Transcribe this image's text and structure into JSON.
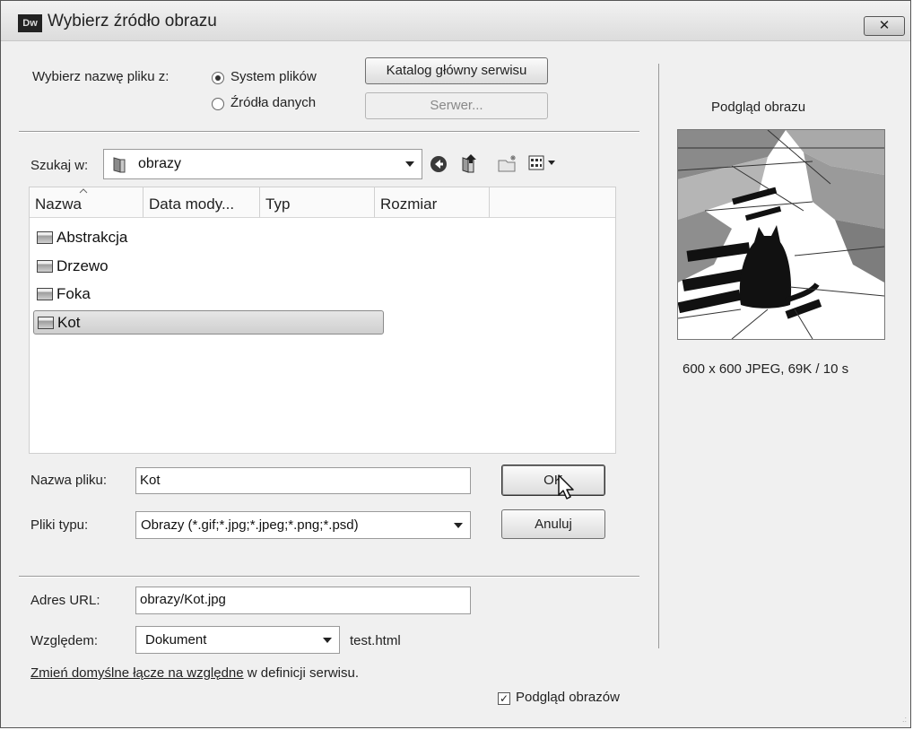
{
  "window": {
    "app_icon_text": "Dw",
    "title": "Wybierz źródło obrazu",
    "close_label": "✕"
  },
  "source": {
    "label": "Wybierz nazwę pliku z:",
    "option_filesystem": "System plików",
    "option_datasources": "Źródła danych",
    "selected": "filesystem",
    "site_root_button": "Katalog główny serwisu",
    "server_button": "Serwer..."
  },
  "lookin": {
    "label": "Szukaj w:",
    "value": "obrazy"
  },
  "filelist": {
    "columns": [
      "Nazwa",
      "Data mody...",
      "Typ",
      "Rozmiar"
    ],
    "sort_column": "Nazwa",
    "rows": [
      "Abstrakcja",
      "Drzewo",
      "Foka",
      "Kot"
    ],
    "selected_row": "Kot"
  },
  "filename": {
    "label": "Nazwa pliku:",
    "value": "Kot"
  },
  "filetype": {
    "label": "Pliki typu:",
    "value": "Obrazy (*.gif;*.jpg;*.jpeg;*.png;*.psd)"
  },
  "buttons": {
    "ok": "OK",
    "cancel": "Anuluj"
  },
  "url": {
    "label": "Adres URL:",
    "value": "obrazy/Kot.jpg"
  },
  "relative": {
    "label": "Względem:",
    "value": "Dokument",
    "document_name": "test.html"
  },
  "footer": {
    "link_text": "Zmień domyślne łącze na względne",
    "suffix_text": " w definicji serwisu.",
    "preview_checkbox_label": "Podgląd obrazów",
    "preview_checked": true
  },
  "preview": {
    "title": "Podgląd obrazu",
    "info": "600 x 600 JPEG, 69K / 10 s"
  },
  "icons": [
    "back-icon",
    "up-folder-icon",
    "new-folder-icon",
    "view-menu-icon",
    "folder-icon",
    "image-file-icon",
    "close-icon"
  ],
  "colors": {
    "window_bg": "#f0f0f0",
    "selection": "#d4d4d4"
  }
}
